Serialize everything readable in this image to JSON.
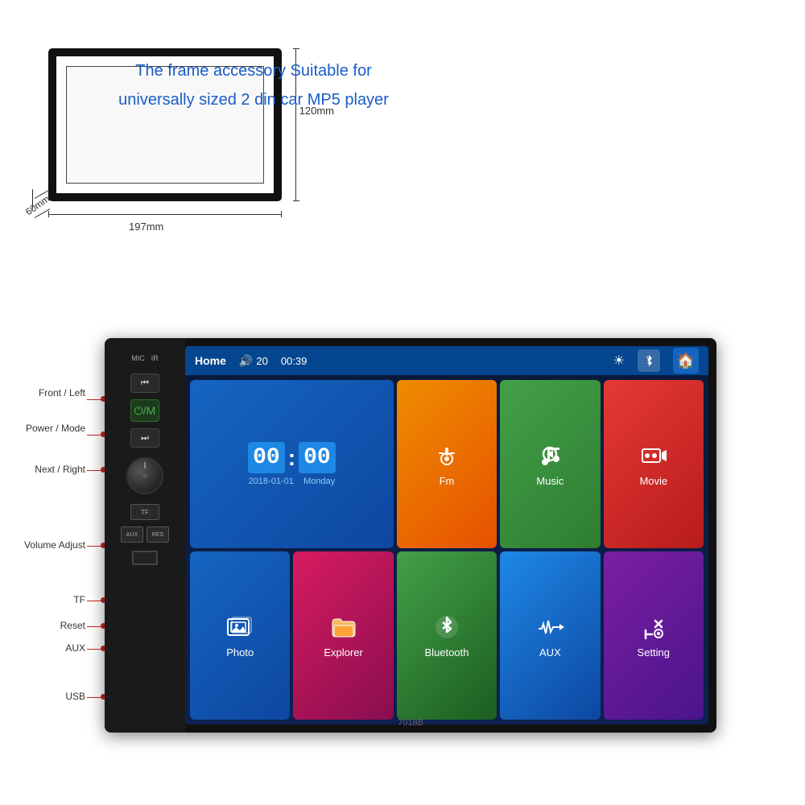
{
  "frame": {
    "dim_width": "197mm",
    "dim_height": "120mm",
    "dim_depth": "60mm",
    "description_line1": "The frame  accessory Suitable for",
    "description_line2": "universally sized 2 din car MP5 player"
  },
  "player": {
    "model": "7018B",
    "status_bar": {
      "home": "Home",
      "volume_icon": "🔊",
      "volume": "20",
      "time": "00:39",
      "brightness_icon": "☀",
      "bluetooth_icon": "⚡",
      "home_icon": "🏠"
    },
    "clock": {
      "hours": "00",
      "minutes": "00",
      "date": "2018-01-01",
      "day": "Monday"
    },
    "apps": [
      {
        "id": "fm",
        "label": "Fm",
        "color_class": "app-tile-fm"
      },
      {
        "id": "music",
        "label": "Music",
        "color_class": "app-tile-music"
      },
      {
        "id": "movie",
        "label": "Movie",
        "color_class": "app-tile-movie"
      },
      {
        "id": "photo",
        "label": "Photo",
        "color_class": "app-tile-photo"
      },
      {
        "id": "explorer",
        "label": "Explorer",
        "color_class": "app-tile-explorer"
      },
      {
        "id": "bluetooth",
        "label": "Bluetooth",
        "color_class": "app-tile-bluetooth"
      },
      {
        "id": "aux",
        "label": "AUX",
        "color_class": "app-tile-aux"
      },
      {
        "id": "setting",
        "label": "Setting",
        "color_class": "app-tile-setting"
      }
    ],
    "labels": {
      "front_left": "Front / Left",
      "power_mode": "Power / Mode",
      "next_right": "Next / Right",
      "volume_adjust": "Volume  Adjust",
      "tf": "TF",
      "reset": "Reset",
      "aux": "AUX",
      "usb": "USB"
    },
    "controls": {
      "mic": "MIC",
      "ir": "IR",
      "tf_slot": "TF",
      "aux_label": "AUX",
      "res_label": "RES"
    }
  }
}
